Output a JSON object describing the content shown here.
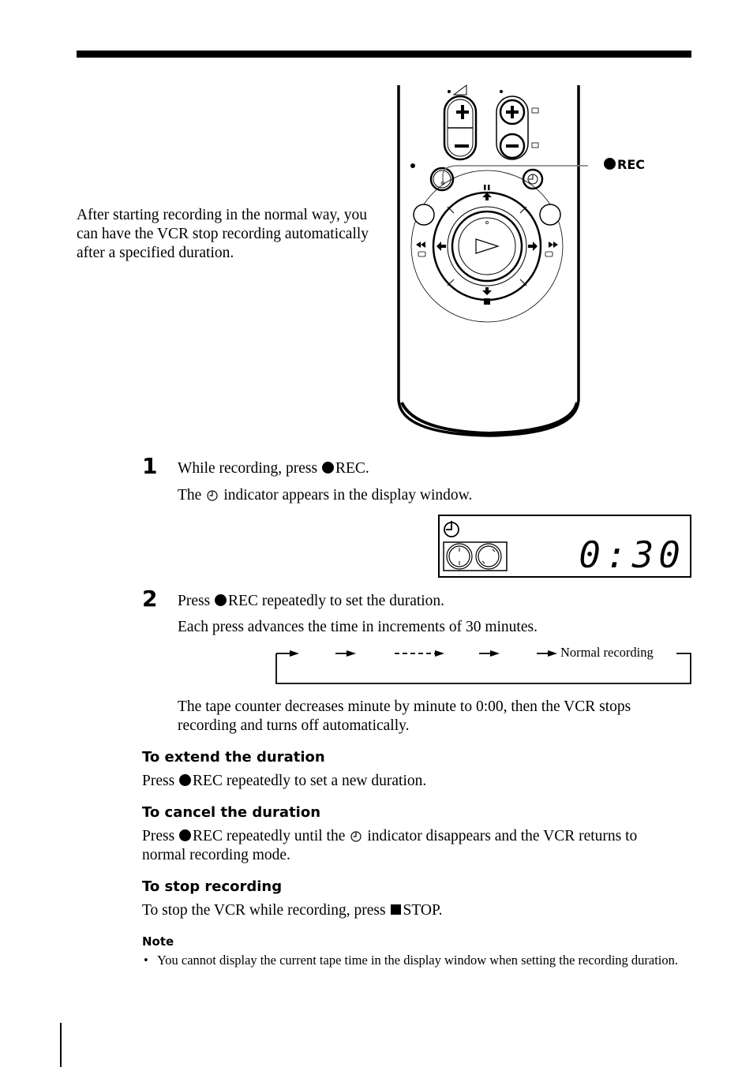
{
  "intro": "After starting recording in the normal way, you can have the VCR stop recording automatically after a specified duration.",
  "illustration": {
    "callout_label": "REC",
    "callout_icon": "filled-circle-icon",
    "remote_buttons": [
      "volume-plus",
      "volume-minus",
      "channel-plus",
      "channel-minus",
      "rec",
      "timer",
      "pause",
      "rewind",
      "play",
      "fast-forward",
      "stop"
    ]
  },
  "steps": [
    {
      "number": "1",
      "text_before": "While recording, press",
      "text_after": "REC.",
      "detail_before": "The",
      "detail_after": "indicator appears in the display window."
    },
    {
      "number": "2",
      "text_before": "Press",
      "text_after": "REC repeatedly to set the duration.",
      "detail": "Each press advances the time in increments of 30 minutes."
    }
  ],
  "display_window": {
    "indicator_icon": "timer-icon",
    "time": "0:30"
  },
  "cycle_diagram": {
    "end_label": "Normal recording"
  },
  "after_step_text": "The tape counter decreases minute by minute to 0:00, then the VCR stops recording and turns off automatically.",
  "sections": [
    {
      "heading": "To extend the duration",
      "text_before": "Press",
      "text_after": "REC repeatedly to set a new duration."
    },
    {
      "heading": "To cancel the duration",
      "text_before": "Press",
      "text_middle": "REC repeatedly until the",
      "text_after": "indicator disappears and the VCR returns to normal recording mode."
    },
    {
      "heading": "To stop recording",
      "text_before": "To stop the VCR while recording, press",
      "text_after": "STOP."
    }
  ],
  "note": {
    "heading": "Note",
    "bullet": "•",
    "items": [
      "You cannot display the current tape time in the display window when setting the recording duration."
    ]
  }
}
